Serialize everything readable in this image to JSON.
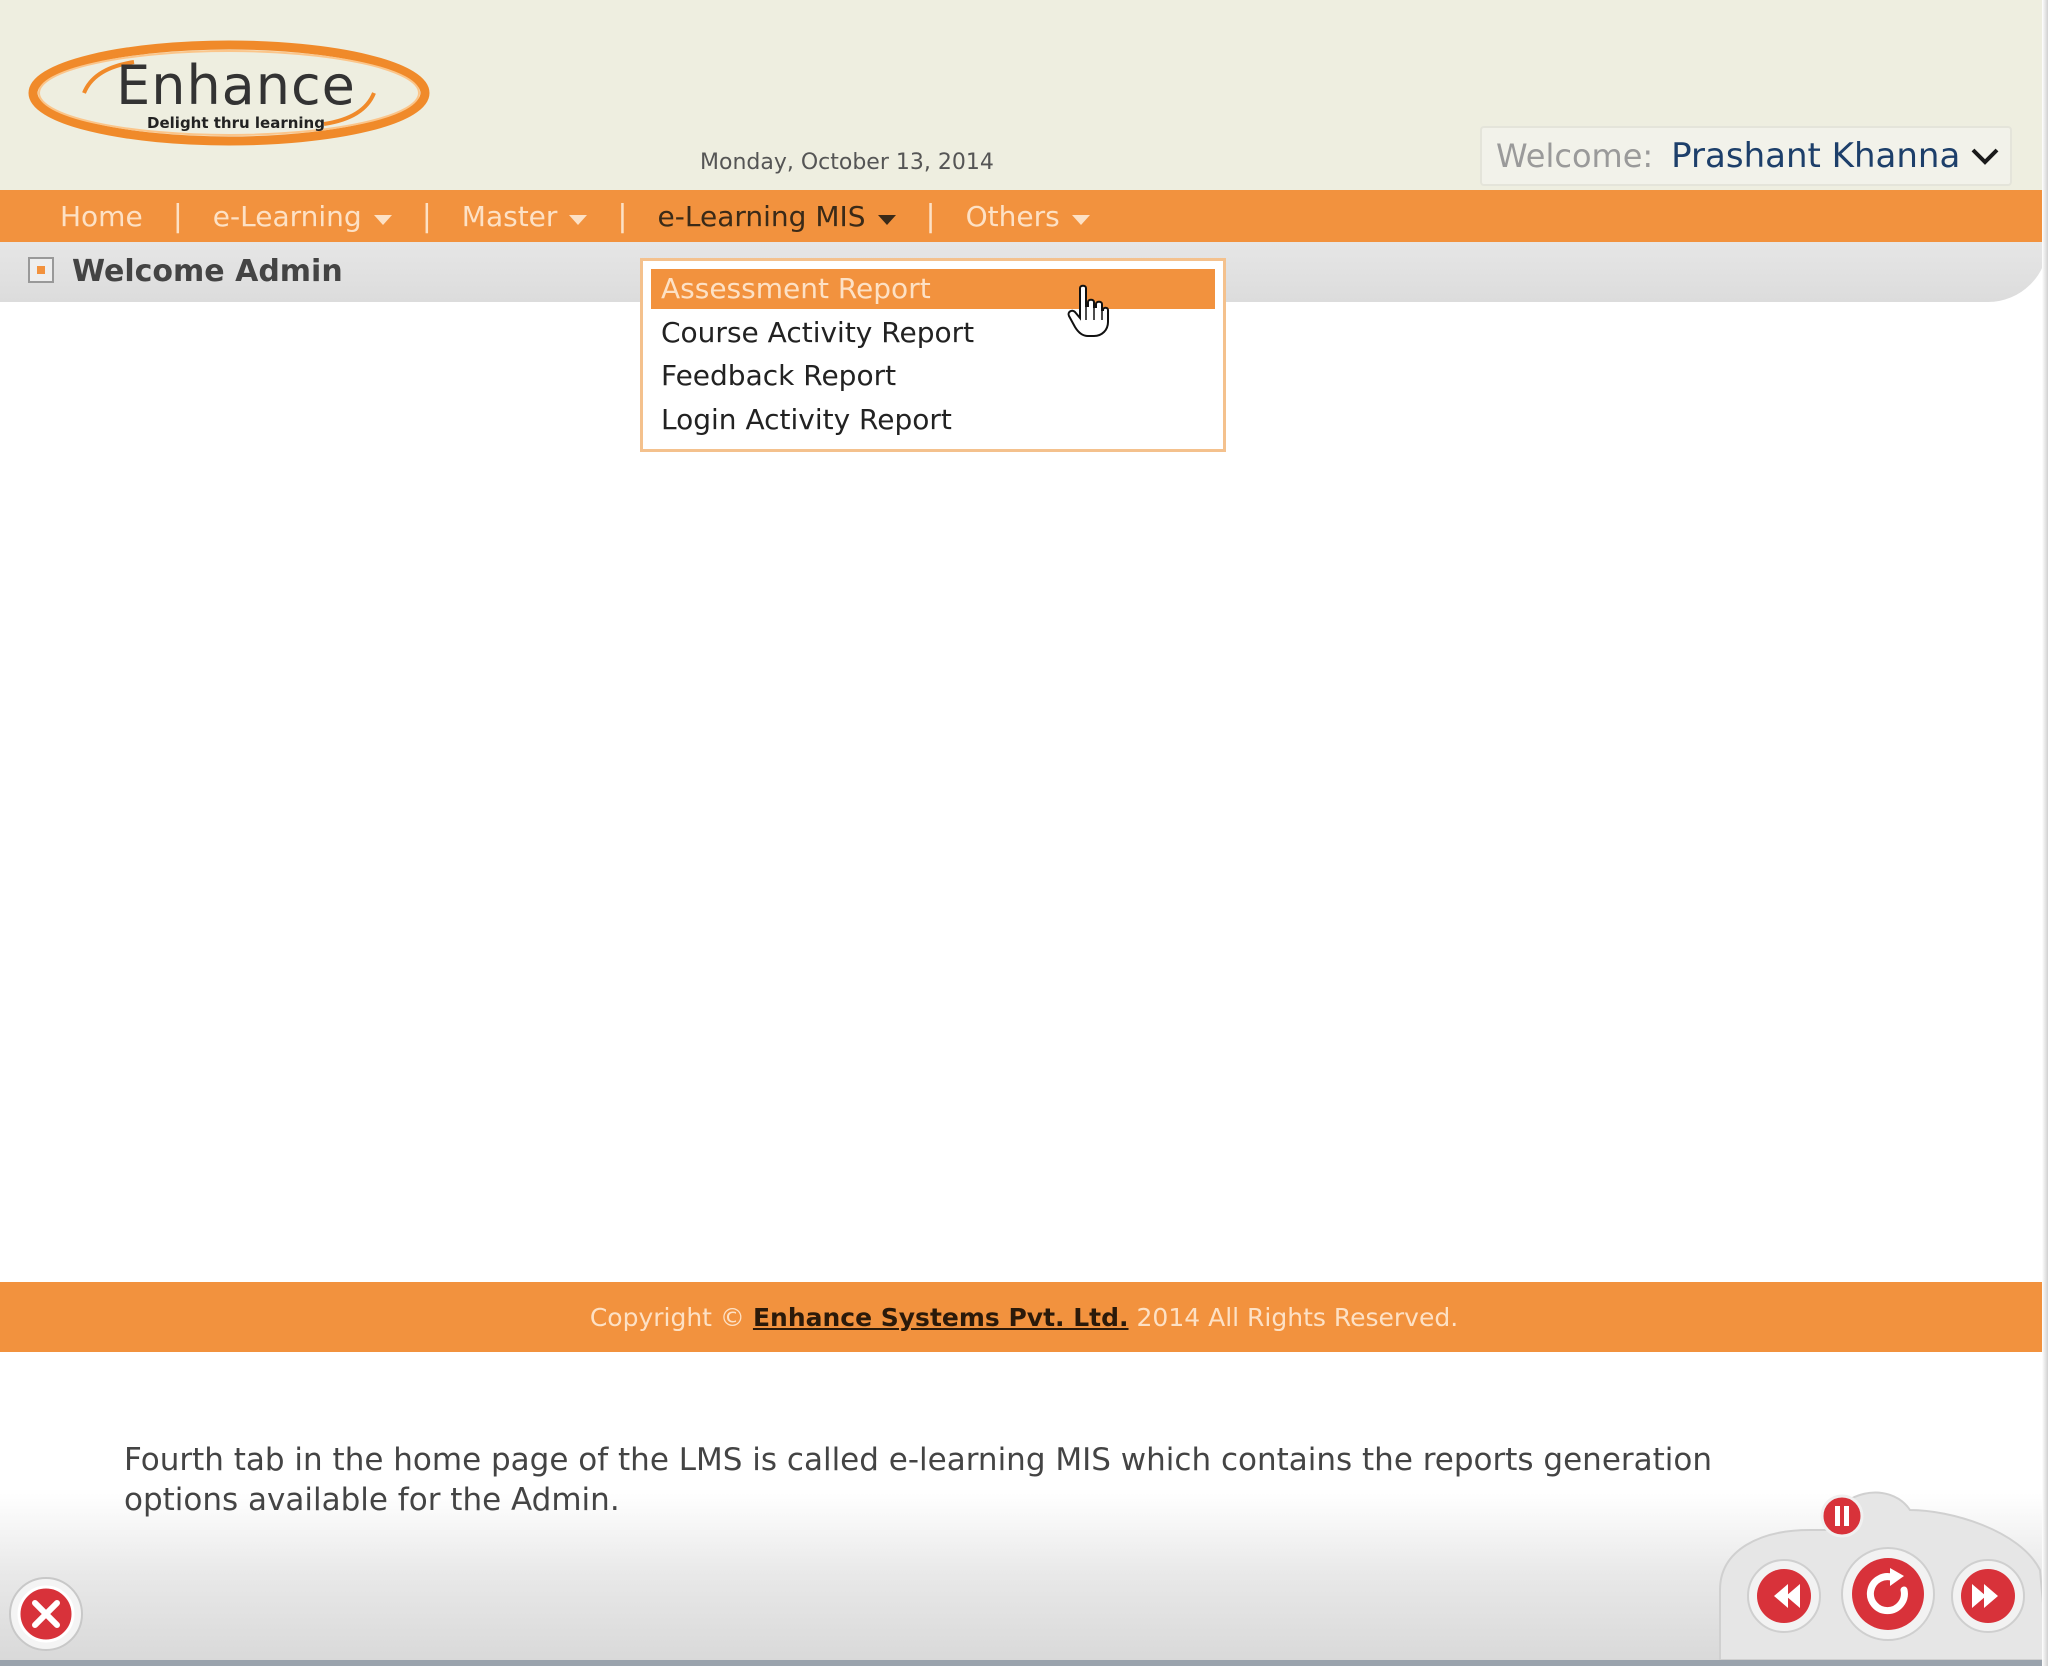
{
  "header": {
    "logo_word": "Enhance",
    "logo_tagline": "Delight thru learning",
    "date": "Monday, October 13, 2014",
    "welcome_label": "Welcome:",
    "user_name": "Prashant Khanna"
  },
  "nav": {
    "items": [
      {
        "label": "Home",
        "has_caret": false
      },
      {
        "label": "e-Learning",
        "has_caret": true
      },
      {
        "label": "Master",
        "has_caret": true
      },
      {
        "label": "e-Learning MIS",
        "has_caret": true
      },
      {
        "label": "Others",
        "has_caret": true
      }
    ],
    "active": "e-Learning MIS"
  },
  "page": {
    "title": "Welcome Admin"
  },
  "dropdown": {
    "items": [
      {
        "label": "Assessment Report"
      },
      {
        "label": "Course Activity Report"
      },
      {
        "label": "Feedback Report"
      },
      {
        "label": "Login Activity Report"
      }
    ],
    "hovered": "Assessment Report"
  },
  "footer": {
    "prefix": "Copyright ©",
    "company": "Enhance Systems Pvt. Ltd.",
    "suffix": "2014 All Rights Reserved."
  },
  "narration": {
    "text": "Fourth tab in the home page of the LMS is called e-learning MIS which contains the reports generation options available for the Admin."
  },
  "colors": {
    "accent": "#f2923e",
    "header_bg": "#eeeee0",
    "user_name": "#1d3f6a",
    "control_red": "#d8323a"
  }
}
